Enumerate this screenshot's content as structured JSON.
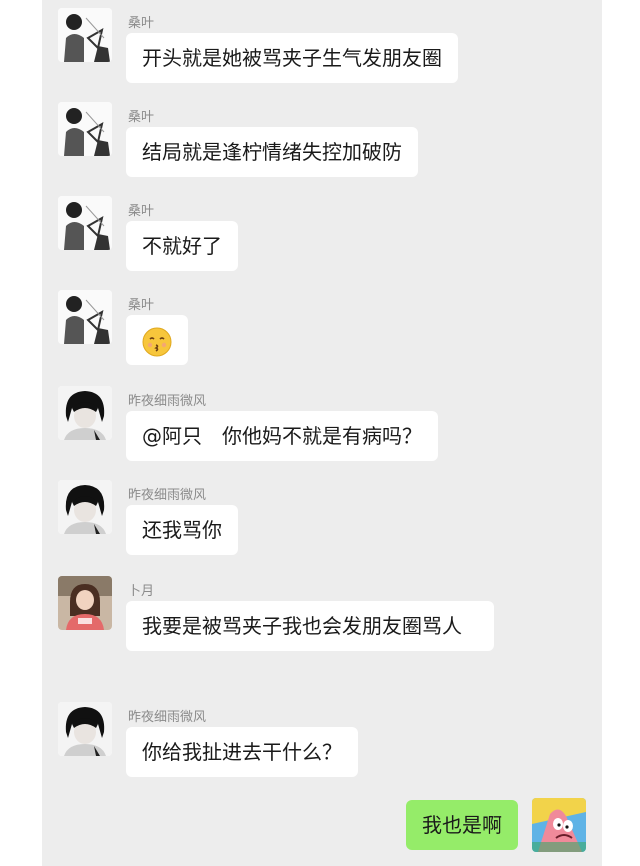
{
  "messages": [
    {
      "sender": "桑叶",
      "text": "开头就是她被骂夹子生气发朋友圈",
      "avatar": "bw-manga-avatar"
    },
    {
      "sender": "桑叶",
      "text": "结局就是逢柠情绪失控加破防",
      "avatar": "bw-manga-avatar"
    },
    {
      "sender": "桑叶",
      "text": "不就好了",
      "avatar": "bw-manga-avatar"
    },
    {
      "sender": "桑叶",
      "text": "",
      "emoji": "kissing-emoji",
      "avatar": "bw-manga-avatar"
    },
    {
      "sender": "昨夜细雨微风",
      "text": "@阿只　你他妈不就是有病吗？",
      "avatar": "dark-hair-avatar"
    },
    {
      "sender": "昨夜细雨微风",
      "text": "还我骂你",
      "avatar": "dark-hair-avatar"
    },
    {
      "sender": "卜月",
      "text": "我要是被骂夹子我也会发朋友圈骂人",
      "avatar": "photo-girl-avatar"
    },
    {
      "sender": "昨夜细雨微风",
      "text": "你给我扯进去干什么？",
      "avatar": "dark-hair-avatar"
    }
  ],
  "self_message": {
    "text": "我也是啊",
    "avatar": "patrick-star-avatar"
  },
  "colors": {
    "background": "#ededed",
    "bubble_in": "#ffffff",
    "bubble_out": "#95ec69"
  }
}
